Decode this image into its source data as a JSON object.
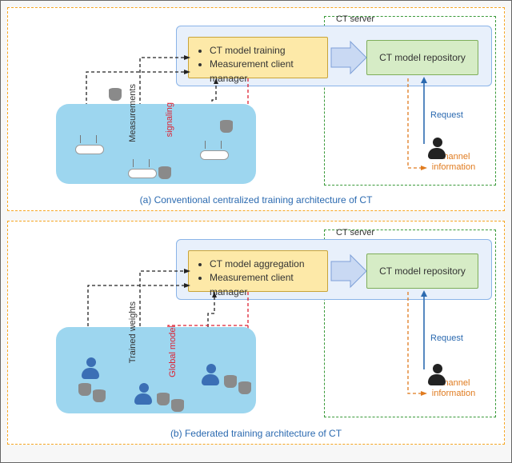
{
  "panel_a": {
    "server_label": "CT server",
    "proc_items": [
      "CT model training",
      "Measurement client manager"
    ],
    "repo_label": "CT model repository",
    "up_label": "Measurements",
    "down_label": "signaling",
    "request_label": "Request",
    "channel_label": "Channel information",
    "caption": "(a) Conventional centralized training architecture of CT"
  },
  "panel_b": {
    "server_label": "CT server",
    "proc_items": [
      "CT model aggregation",
      "Measurement client manager"
    ],
    "repo_label": "CT model repository",
    "up_label": "Trained weights",
    "down_label": "Global model",
    "request_label": "Request",
    "channel_label": "Channel information",
    "caption": "(b) Federated training architecture of CT"
  }
}
